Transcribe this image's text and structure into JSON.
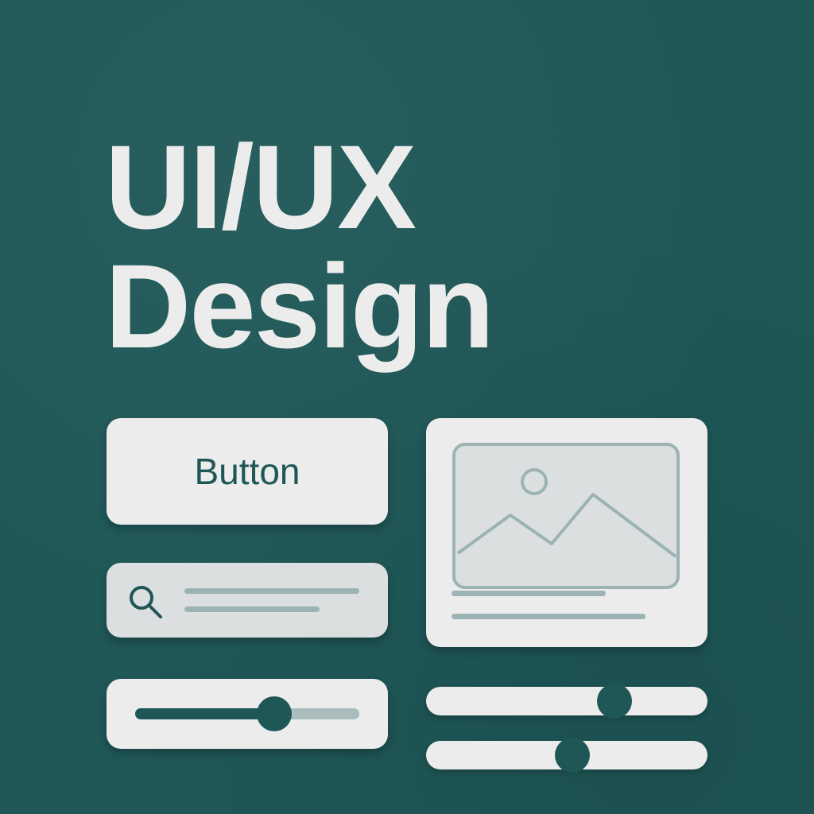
{
  "headline": {
    "line1": "UI/UX",
    "line2": "Design"
  },
  "button": {
    "label": "Button"
  },
  "search": {
    "icon": "search-icon",
    "placeholder_lines": 2
  },
  "slider": {
    "value": 0.62
  },
  "image_card": {
    "icon": "image-placeholder-icon",
    "caption_lines": 2
  },
  "toggles": [
    {
      "value": 0.67
    },
    {
      "value": 0.52
    }
  ],
  "colors": {
    "background": "#1f5757",
    "card": "#ececec",
    "accent": "#1f5757",
    "muted": "#9bb3b3"
  }
}
